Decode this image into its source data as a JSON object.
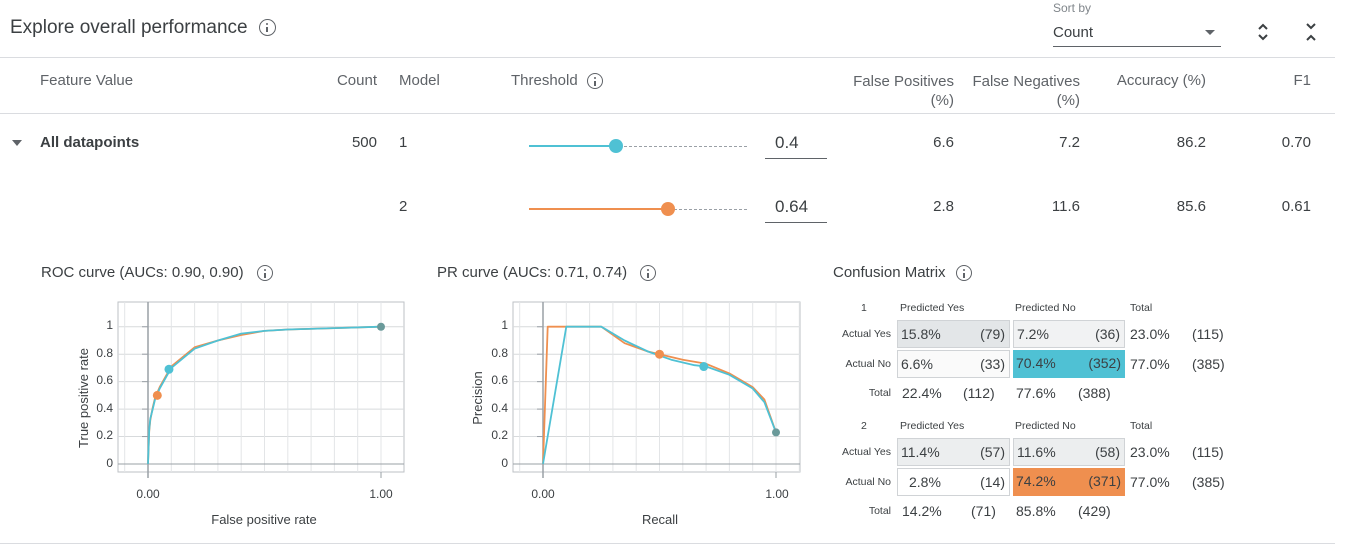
{
  "header": {
    "title": "Explore overall performance",
    "sort_label": "Sort by",
    "sort_value": "Count"
  },
  "columns": {
    "feature_value": "Feature Value",
    "count": "Count",
    "model": "Model",
    "threshold": "Threshold",
    "false_positives": "False Positives",
    "false_positives_unit": "(%)",
    "false_negatives": "False Negatives",
    "false_negatives_unit": "(%)",
    "accuracy": "Accuracy (%)",
    "f1": "F1"
  },
  "row": {
    "feature_value": "All datapoints",
    "count": "500",
    "models": [
      {
        "model": "1",
        "threshold": "0.4",
        "threshold_value": 0.4,
        "false_positives": "6.6",
        "false_negatives": "7.2",
        "accuracy": "86.2",
        "f1": "0.70",
        "color": "#4fc1d4"
      },
      {
        "model": "2",
        "threshold": "0.64",
        "threshold_value": 0.64,
        "false_positives": "2.8",
        "false_negatives": "11.6",
        "accuracy": "85.6",
        "f1": "0.61",
        "color": "#ef8f4f"
      }
    ]
  },
  "roc": {
    "title": "ROC curve (AUCs: 0.90, 0.90)",
    "xlabel": "False positive rate",
    "ylabel": "True positive rate",
    "x_ticks": [
      "0.00",
      "1.00"
    ],
    "y_ticks": [
      "1",
      "0.8",
      "0.6",
      "0.4",
      "0.2",
      "0"
    ]
  },
  "pr": {
    "title": "PR curve (AUCs: 0.71, 0.74)",
    "xlabel": "Recall",
    "ylabel": "Precision",
    "x_ticks": [
      "0.00",
      "1.00"
    ],
    "y_ticks": [
      "1",
      "0.8",
      "0.6",
      "0.4",
      "0.2",
      "0"
    ]
  },
  "chart_data": [
    {
      "type": "line",
      "title": "ROC curve (AUCs: 0.90, 0.90)",
      "xlabel": "False positive rate",
      "ylabel": "True positive rate",
      "xlim": [
        0,
        1
      ],
      "ylim": [
        0,
        1
      ],
      "series": [
        {
          "color": "#4fc1d4",
          "x": [
            0,
            0.005,
            0.01,
            0.02,
            0.03,
            0.05,
            0.08,
            0.1,
            0.15,
            0.2,
            0.3,
            0.4,
            0.5,
            0.6,
            0.8,
            1.0
          ],
          "y": [
            0,
            0.25,
            0.33,
            0.4,
            0.47,
            0.55,
            0.64,
            0.7,
            0.77,
            0.84,
            0.9,
            0.95,
            0.97,
            0.98,
            0.99,
            1.0
          ],
          "marker": [
            0.09,
            0.69
          ]
        },
        {
          "color": "#ef8f4f",
          "x": [
            0,
            0.005,
            0.01,
            0.02,
            0.03,
            0.05,
            0.08,
            0.1,
            0.15,
            0.2,
            0.3,
            0.4,
            0.5,
            0.6,
            0.8,
            1.0
          ],
          "y": [
            0,
            0.24,
            0.32,
            0.41,
            0.48,
            0.56,
            0.65,
            0.71,
            0.78,
            0.85,
            0.9,
            0.94,
            0.97,
            0.98,
            0.99,
            1.0
          ],
          "marker": [
            0.04,
            0.5
          ]
        }
      ]
    },
    {
      "type": "line",
      "title": "PR curve (AUCs: 0.71, 0.74)",
      "xlabel": "Recall",
      "ylabel": "Precision",
      "xlim": [
        0,
        1
      ],
      "ylim": [
        0,
        1
      ],
      "series": [
        {
          "color": "#4fc1d4",
          "x": [
            0,
            0.1,
            0.25,
            0.35,
            0.45,
            0.55,
            0.65,
            0.7,
            0.8,
            0.9,
            0.95,
            1.0
          ],
          "y": [
            0,
            1.0,
            1.0,
            0.9,
            0.82,
            0.76,
            0.72,
            0.71,
            0.65,
            0.55,
            0.45,
            0.23
          ],
          "marker": [
            0.69,
            0.71
          ]
        },
        {
          "color": "#ef8f4f",
          "x": [
            0,
            0.02,
            0.05,
            0.25,
            0.35,
            0.45,
            0.5,
            0.6,
            0.7,
            0.8,
            0.9,
            0.95,
            1.0
          ],
          "y": [
            0,
            1.0,
            1.0,
            1.0,
            0.88,
            0.82,
            0.8,
            0.76,
            0.73,
            0.66,
            0.56,
            0.47,
            0.23
          ],
          "marker": [
            0.5,
            0.8
          ]
        }
      ]
    }
  ],
  "confusion": {
    "title": "Confusion Matrix",
    "pred_yes": "Predicted Yes",
    "pred_no": "Predicted No",
    "total": "Total",
    "actual_yes": "Actual Yes",
    "actual_no": "Actual No",
    "models": [
      {
        "id": "1",
        "color": "#4fc1d4",
        "cells": {
          "yy_pct": "15.8%",
          "yy_n": "(79)",
          "yn_pct": "7.2%",
          "yn_n": "(36)",
          "y_tot_pct": "23.0%",
          "y_tot_n": "(115)",
          "ny_pct": "6.6%",
          "ny_n": "(33)",
          "nn_pct": "70.4%",
          "nn_n": "(352)",
          "n_tot_pct": "77.0%",
          "n_tot_n": "(385)",
          "t_yes_pct": "22.4%",
          "t_yes_n": "(112)",
          "t_no_pct": "77.6%",
          "t_no_n": "(388)"
        }
      },
      {
        "id": "2",
        "color": "#ef8f4f",
        "cells": {
          "yy_pct": "11.4%",
          "yy_n": "(57)",
          "yn_pct": "11.6%",
          "yn_n": "(58)",
          "y_tot_pct": "23.0%",
          "y_tot_n": "(115)",
          "ny_pct": "2.8%",
          "ny_n": "(14)",
          "nn_pct": "74.2%",
          "nn_n": "(371)",
          "n_tot_pct": "77.0%",
          "n_tot_n": "(385)",
          "t_yes_pct": "14.2%",
          "t_yes_n": "(71)",
          "t_no_pct": "85.8%",
          "t_no_n": "(429)"
        }
      }
    ]
  }
}
